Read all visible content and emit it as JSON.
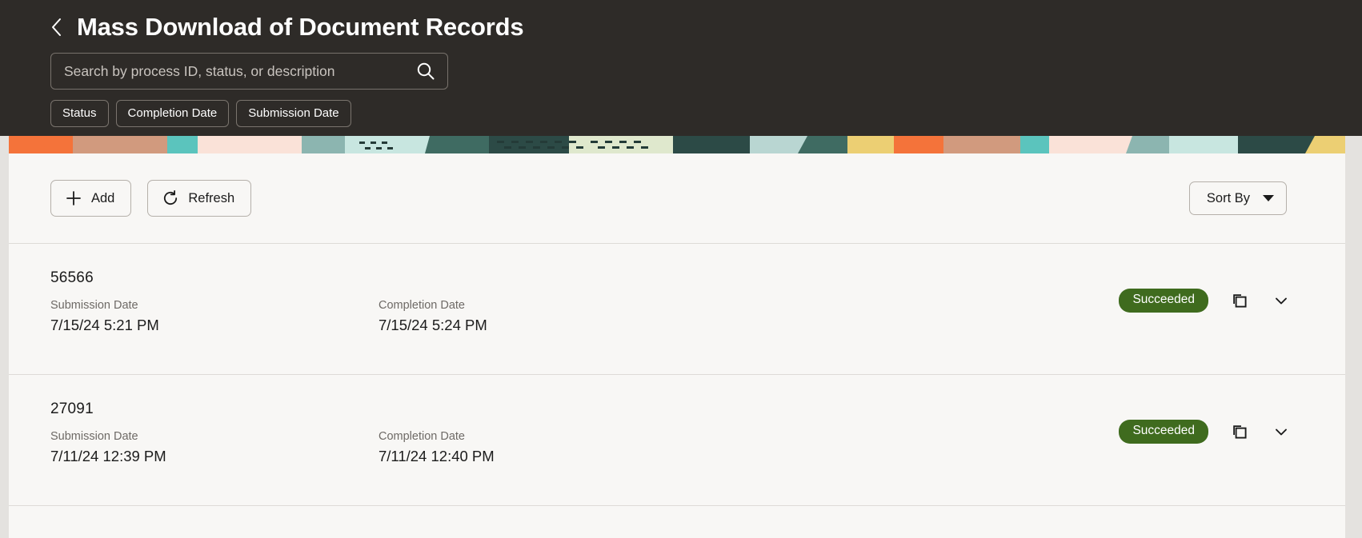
{
  "header": {
    "back_icon": "chevron-left-icon",
    "title": "Mass Download of Document Records",
    "search": {
      "placeholder": "Search by process ID, status, or description",
      "value": "",
      "icon": "search-icon"
    },
    "filters": [
      {
        "label": "Status"
      },
      {
        "label": "Completion Date"
      },
      {
        "label": "Submission Date"
      }
    ]
  },
  "toolbar": {
    "add_label": "Add",
    "add_icon": "plus-icon",
    "refresh_label": "Refresh",
    "refresh_icon": "refresh-icon",
    "sort_label": "Sort By",
    "sort_icon": "caret-down-icon"
  },
  "labels": {
    "submission_date": "Submission Date",
    "completion_date": "Completion Date"
  },
  "records": [
    {
      "id": "56566",
      "submission_date": "7/15/24 5:21 PM",
      "completion_date": "7/15/24 5:24 PM",
      "status": "Succeeded",
      "copy_icon": "copy-icon",
      "expand_icon": "chevron-down-icon"
    },
    {
      "id": "27091",
      "submission_date": "7/11/24 12:39 PM",
      "completion_date": "7/11/24 12:40 PM",
      "status": "Succeeded",
      "copy_icon": "copy-icon",
      "expand_icon": "chevron-down-icon"
    }
  ],
  "colors": {
    "header_background": "#2e2b28",
    "panel_background": "#f8f7f5",
    "status_success": "#3f6b1e",
    "gutter": "#e4e2df",
    "divider": "#dedbd7"
  }
}
